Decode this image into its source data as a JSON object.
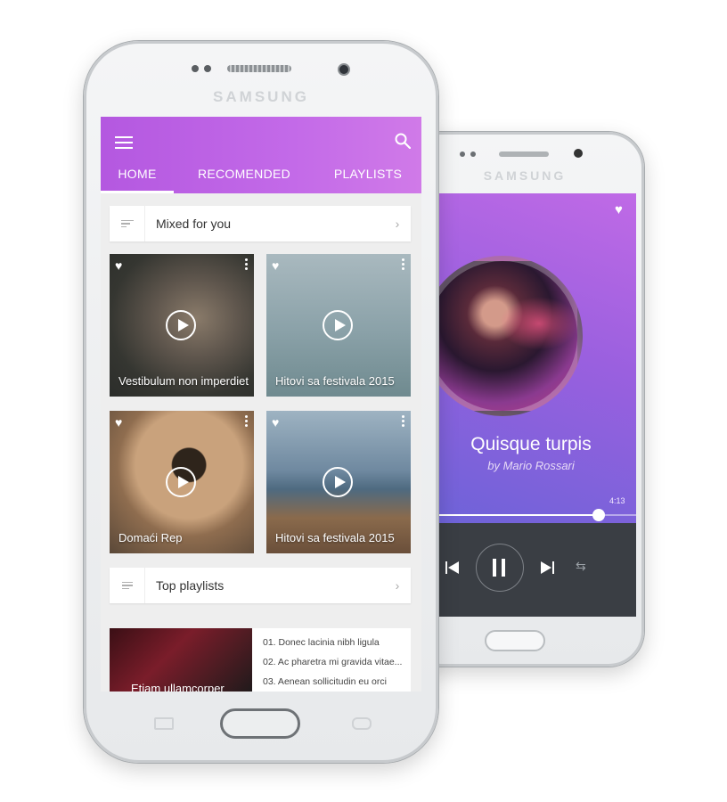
{
  "front_phone": {
    "brand": "SAMSUNG",
    "tabs": [
      {
        "label": "HOME"
      },
      {
        "label": "RECOMENDED"
      },
      {
        "label": "PLAYLISTS"
      }
    ],
    "sections": {
      "mixed": {
        "label": "Mixed for you"
      },
      "top": {
        "label": "Top playlists"
      }
    },
    "tiles": [
      {
        "title": "Vestibulum non imperdiet"
      },
      {
        "title": "Hitovi sa festivala 2015"
      },
      {
        "title": "Domaći Rep"
      },
      {
        "title": "Hitovi sa festivala 2015"
      }
    ],
    "top_playlist": {
      "title": "Etiam ullamcorper",
      "tracks": [
        "01.  Donec lacinia nibh ligula",
        "02.  Ac pharetra mi gravida vitae...",
        "03.  Aenean sollicitudin eu orci"
      ]
    },
    "icons": [
      "menu-icon",
      "search-icon",
      "sort-icon",
      "playlist-icon",
      "chevron-right-icon",
      "heart-icon",
      "more-vert-icon",
      "play-circle-icon"
    ]
  },
  "back_phone": {
    "brand": "SAMSUNG",
    "player": {
      "song_title": "Quisque turpis",
      "artist": "by Mario Rossari",
      "duration": "4:13",
      "progress": 0.82
    },
    "icons": [
      "heart-icon",
      "skip-previous-icon",
      "pause-icon",
      "skip-next-icon",
      "shuffle-icon"
    ]
  }
}
